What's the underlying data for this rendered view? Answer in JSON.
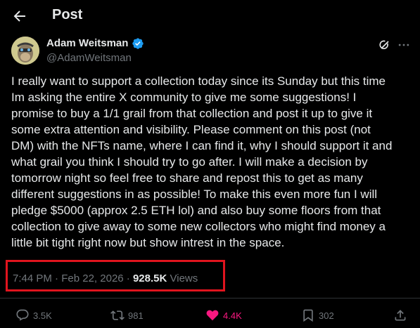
{
  "header": {
    "title": "Post"
  },
  "post": {
    "author_name": "Adam Weitsman",
    "handle": "@AdamWeitsman",
    "lines": [
      "I really want to support a collection today since its Sunday but this time",
      "Im asking the entire X community to give me some suggestions! I",
      "promise to buy a 1/1 grail from that collection and post it up to give it",
      "some extra attention and visibility.  Please comment on this post (not",
      "DM) with the NFTs name, where I can find it, why I should support it and",
      "what grail you think I should try to go after. I will make a decision by",
      "tomorrow night so feel free to share and repost this to get as many",
      "different suggestions in as possible!  To make this even more fun I will",
      "pledge $5000 (approx 2.5 ETH lol) and also buy some floors from that",
      "collection to give away to some new collectors who might find money a",
      "little bit tight right now but show intrest in the space."
    ],
    "time": "7:44 PM",
    "sep": "·",
    "date": "Feb 22, 2026",
    "views_count": "928.5K",
    "views_label": "Views"
  },
  "actions": {
    "replies": "3.5K",
    "reposts": "981",
    "likes": "4.4K",
    "bookmarks": "302"
  },
  "colors": {
    "background": "#000000",
    "text": "#e7e9ea",
    "muted": "#71767b",
    "like_pink": "#f91880",
    "verified_blue": "#1d9bf0",
    "highlight_red": "#e0141e"
  },
  "icons": {
    "back": "arrow-left-icon",
    "verified": "verified-badge-icon",
    "grok": "grok-icon",
    "more": "more-horizontal-icon",
    "reply": "reply-icon",
    "repost": "repost-icon",
    "like": "heart-filled-icon",
    "bookmark": "bookmark-icon",
    "share": "share-icon"
  }
}
